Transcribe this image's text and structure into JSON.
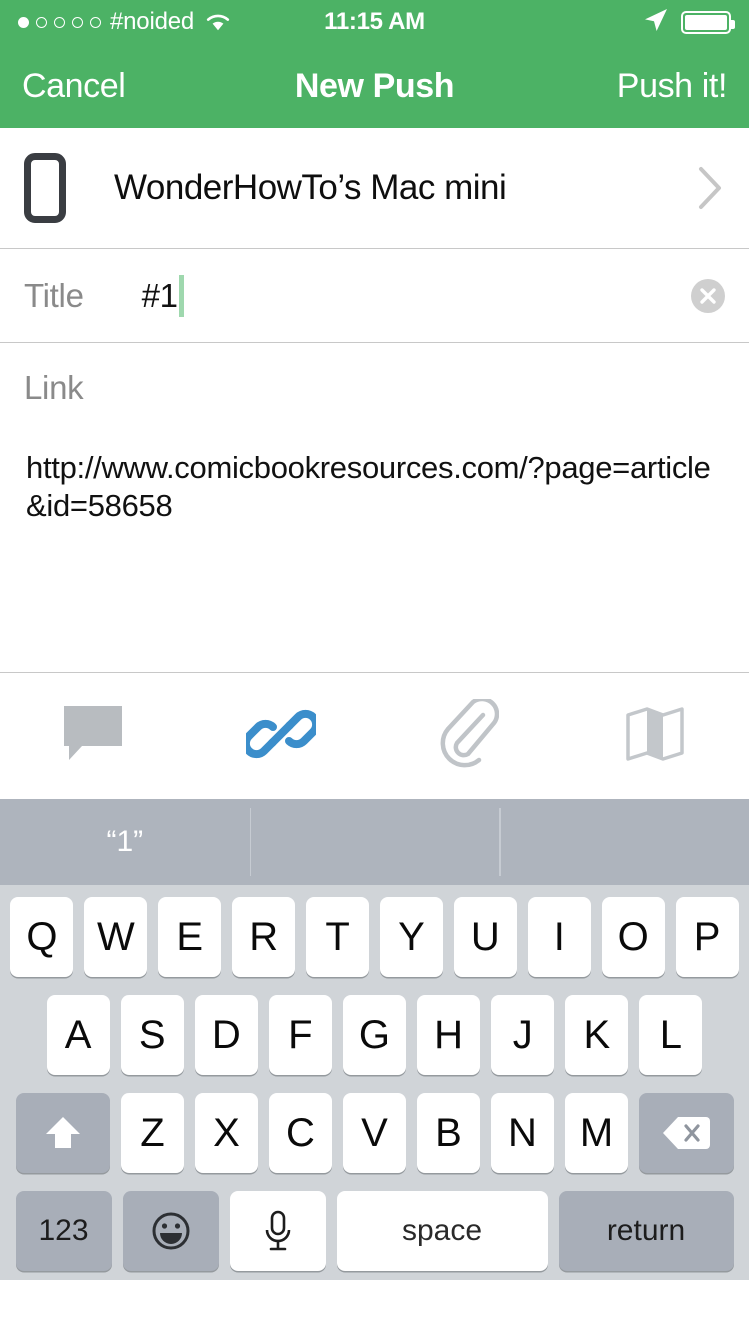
{
  "status_bar": {
    "carrier": "#noided",
    "signal_dots_total": 5,
    "signal_dots_filled": 1,
    "wifi_icon": "wifi-icon",
    "time": "11:15 AM",
    "location_icon": "location-arrow-icon",
    "battery_icon": "battery-full-icon",
    "background_color": "#4cb265",
    "text_color": "#ffffff"
  },
  "nav_bar": {
    "cancel_label": "Cancel",
    "title": "New Push",
    "push_label": "Push it!",
    "background_color": "#4cb265"
  },
  "device_row": {
    "device_icon": "phone-device-icon",
    "device_name": "WonderHowTo’s Mac mini",
    "chevron_icon": "chevron-right-icon"
  },
  "title_field": {
    "label": "Title",
    "value": "#1",
    "placeholder": "Title",
    "caret_color": "#9fd8ae",
    "clear_icon": "clear-circle-icon"
  },
  "link_field": {
    "label": "Link",
    "value": "http://www.comicbookresources.com/?page=article&id=58658",
    "placeholder": "Link"
  },
  "icon_toolbar": {
    "items": [
      {
        "name": "note-bubble-icon",
        "label": "Note",
        "active": false,
        "color": "#b8bcc0"
      },
      {
        "name": "link-chain-icon",
        "label": "Link",
        "active": true,
        "color": "#3b8ecb"
      },
      {
        "name": "paperclip-icon",
        "label": "File",
        "active": false,
        "color": "#b8bcc0"
      },
      {
        "name": "map-icon",
        "label": "Address",
        "active": false,
        "color": "#b8bcc0"
      }
    ],
    "accent_color": "#3b8ecb"
  },
  "keyboard": {
    "suggestions": [
      "“1”",
      "",
      ""
    ],
    "row1": [
      "Q",
      "W",
      "E",
      "R",
      "T",
      "Y",
      "U",
      "I",
      "O",
      "P"
    ],
    "row2": [
      "A",
      "S",
      "D",
      "F",
      "G",
      "H",
      "J",
      "K",
      "L"
    ],
    "row3": [
      "Z",
      "X",
      "C",
      "V",
      "B",
      "N",
      "M"
    ],
    "shift_icon": "shift-arrow-icon",
    "backspace_icon": "backspace-delete-icon",
    "numbers_label": "123",
    "emoji_icon": "emoji-smiley-icon",
    "mic_icon": "microphone-icon",
    "space_label": "space",
    "return_label": "return",
    "background_color": "#d0d4d8",
    "suggestion_bar_color": "#aeb4bd"
  }
}
